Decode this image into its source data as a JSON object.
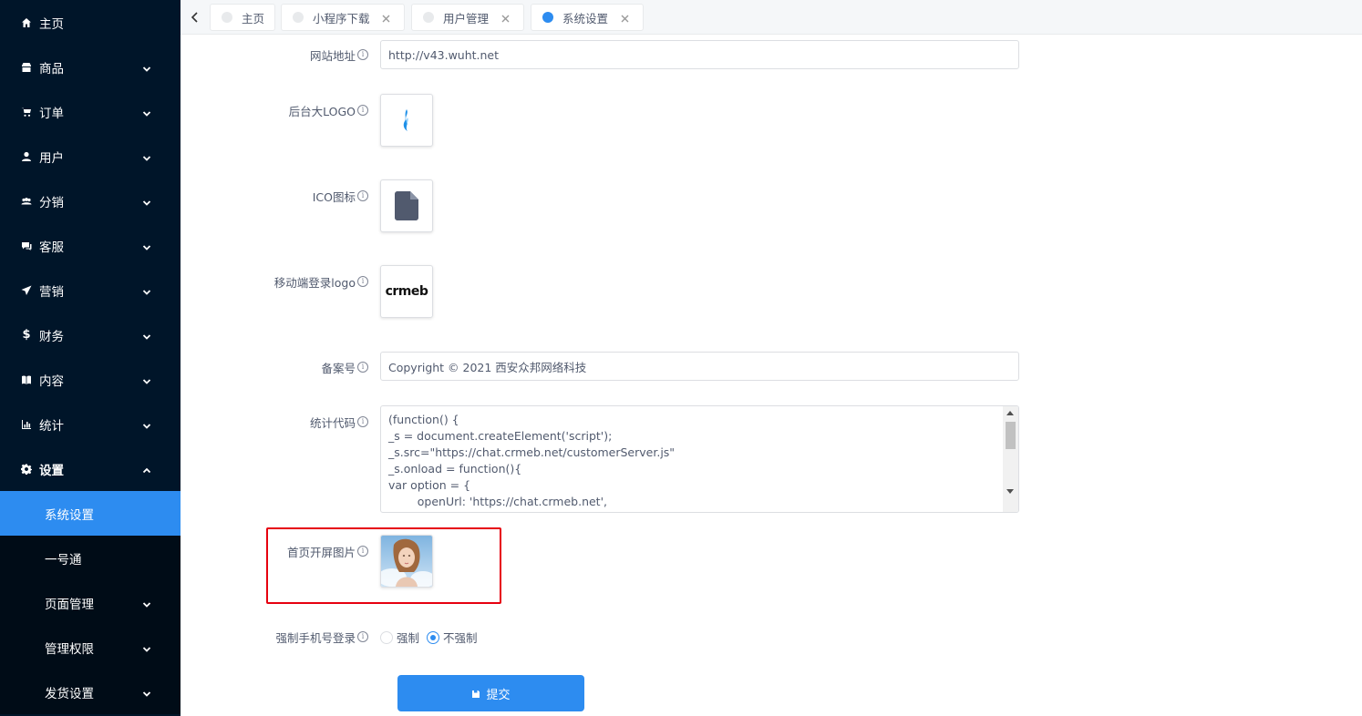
{
  "sidebar": {
    "items": [
      {
        "label": "主页",
        "icon": "home-icon"
      },
      {
        "label": "商品",
        "icon": "shop-icon"
      },
      {
        "label": "订单",
        "icon": "cart-icon"
      },
      {
        "label": "用户",
        "icon": "user-icon"
      },
      {
        "label": "分销",
        "icon": "group-icon"
      },
      {
        "label": "客服",
        "icon": "chat-icon"
      },
      {
        "label": "营销",
        "icon": "send-icon"
      },
      {
        "label": "财务",
        "icon": "dollar-icon"
      },
      {
        "label": "内容",
        "icon": "book-icon"
      },
      {
        "label": "统计",
        "icon": "bar-chart-icon"
      },
      {
        "label": "设置",
        "icon": "gear-icon"
      }
    ],
    "subitems": [
      {
        "label": "系统设置"
      },
      {
        "label": "一号通"
      },
      {
        "label": "页面管理"
      },
      {
        "label": "管理权限"
      },
      {
        "label": "发货设置"
      }
    ]
  },
  "tabs": [
    {
      "label": "主页"
    },
    {
      "label": "小程序下载"
    },
    {
      "label": "用户管理"
    },
    {
      "label": "系统设置"
    }
  ],
  "form": {
    "site_url": {
      "label": "网站地址",
      "value": "http://v43.wuht.net"
    },
    "admin_logo": {
      "label": "后台大LOGO"
    },
    "ico": {
      "label": "ICO图标"
    },
    "mobile_logo": {
      "label": "移动端登录logo",
      "logo_text": "crmeb"
    },
    "icp": {
      "label": "备案号",
      "value": "Copyright © 2021 西安众邦网络科技"
    },
    "stats_code": {
      "label": "统计代码",
      "lines": [
        "(function() {",
        "_s = document.createElement('script');",
        "_s.src=\"https://chat.crmeb.net/customerServer.js\"",
        "_s.onload = function(){",
        "var option = {",
        "        openUrl: 'https://chat.crmeb.net',"
      ]
    },
    "splash_image": {
      "label": "首页开屏图片"
    },
    "force_phone": {
      "label": "强制手机号登录",
      "options": [
        "强制",
        "不强制"
      ],
      "selected": "不强制"
    },
    "submit_label": "提交"
  },
  "colors": {
    "sidebar_bg": "#001529",
    "accent": "#2d8cf0",
    "highlight": "#e6000f"
  }
}
